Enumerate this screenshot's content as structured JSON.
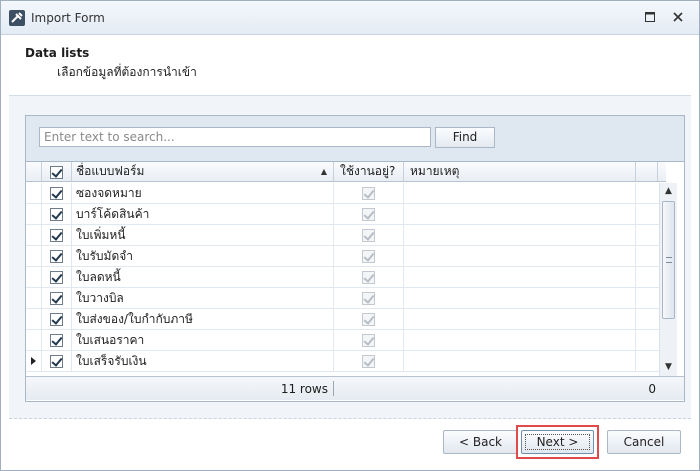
{
  "window": {
    "title": "Import Form"
  },
  "header": {
    "title": "Data lists",
    "subtitle": "เลือกข้อมูลที่ต้องการนำเข้า"
  },
  "search": {
    "placeholder": "Enter text to search...",
    "find_label": "Find"
  },
  "grid": {
    "columns": {
      "name": "ชื่อแบบฟอร์ม",
      "in_use": "ใช้งานอยู่?",
      "note": "หมายเหตุ"
    },
    "rows": [
      {
        "name": "ซองจดหมาย",
        "checked": true,
        "in_use": true,
        "note": ""
      },
      {
        "name": "บาร์โค้ดสินค้า",
        "checked": true,
        "in_use": true,
        "note": ""
      },
      {
        "name": "ใบเพิ่มหนี้",
        "checked": true,
        "in_use": true,
        "note": ""
      },
      {
        "name": "ใบรับมัดจำ",
        "checked": true,
        "in_use": true,
        "note": ""
      },
      {
        "name": "ใบลดหนี้",
        "checked": true,
        "in_use": true,
        "note": ""
      },
      {
        "name": "ใบวางบิล",
        "checked": true,
        "in_use": true,
        "note": ""
      },
      {
        "name": "ใบส่งของ/ใบกำกับภาษี",
        "checked": true,
        "in_use": true,
        "note": ""
      },
      {
        "name": "ใบเสนอราคา",
        "checked": true,
        "in_use": true,
        "note": ""
      },
      {
        "name": "ใบเสร็จรับเงิน",
        "checked": true,
        "in_use": true,
        "note": "",
        "current": true
      }
    ],
    "footer": {
      "rows_text": "11 rows",
      "total": "0"
    }
  },
  "buttons": {
    "back": "< Back",
    "next": "Next >",
    "cancel": "Cancel"
  },
  "colors": {
    "highlight": "#e04a4a",
    "accent": "#6f8fb1"
  }
}
